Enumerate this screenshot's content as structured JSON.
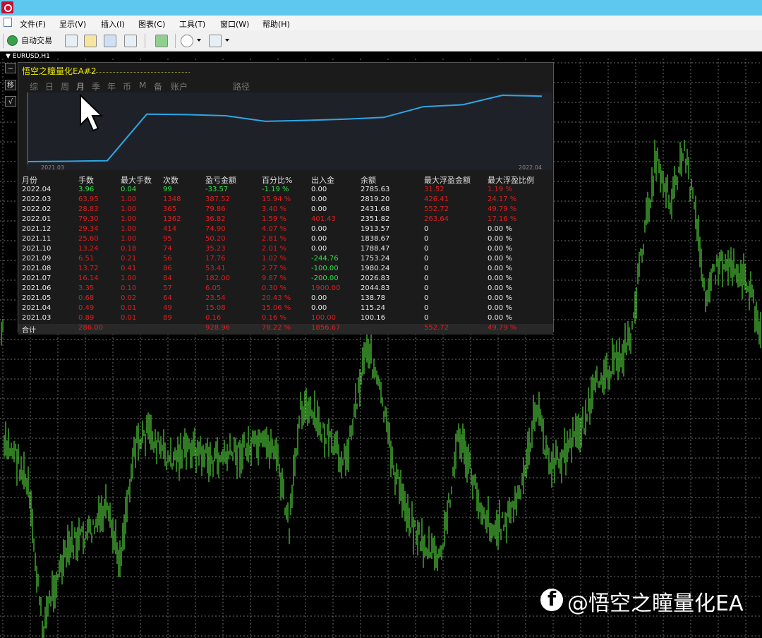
{
  "menubar": {
    "items": [
      "文件(F)",
      "显示(V)",
      "插入(I)",
      "图表(C)",
      "工具(T)",
      "窗口(W)",
      "帮助(H)"
    ]
  },
  "toolbar": {
    "autotrade_label": "自动交易"
  },
  "chart": {
    "symbol_label": "▼ EURUSD,H1",
    "side_buttons": [
      "−",
      "移",
      "√"
    ]
  },
  "panel": {
    "ea_name": "悟空之瞳量化EA#2",
    "tabs": [
      "综",
      "日",
      "周",
      "月",
      "季",
      "年",
      "币",
      "M",
      "备",
      "账户",
      "路径"
    ],
    "active_tab": "月",
    "balance_chart": {
      "x_start_label": "2021.03",
      "x_end_label": "2022.04",
      "line_color": "#2ea6e6"
    },
    "table": {
      "headers": [
        "月份",
        "手数",
        "最大手数",
        "次数",
        "盈亏金额",
        "百分比%",
        "出入金",
        "余额",
        "最大浮盈金额",
        "最大浮盈比例"
      ],
      "rows": [
        [
          "2022.04",
          "3.96",
          "0.04",
          "99",
          "-33.57",
          "-1.19 %",
          "0.00",
          "2785.63",
          "31.52",
          "1.19 %"
        ],
        [
          "2022.03",
          "63.95",
          "1.00",
          "1348",
          "387.52",
          "15.94 %",
          "0.00",
          "2819.20",
          "426.41",
          "24.17 %"
        ],
        [
          "2022.02",
          "28.83",
          "1.00",
          "365",
          "79.86",
          "3.40 %",
          "0.00",
          "2431.68",
          "552.72",
          "49.79 %"
        ],
        [
          "2022.01",
          "79.30",
          "1.00",
          "1362",
          "36.82",
          "1.59 %",
          "401.43",
          "2351.82",
          "263.64",
          "17.16 %"
        ],
        [
          "2021.12",
          "29.34",
          "1.00",
          "414",
          "74.90",
          "4.07 %",
          "0.00",
          "1913.57",
          "0",
          "0.00 %"
        ],
        [
          "2021.11",
          "25.60",
          "1.00",
          "95",
          "50.20",
          "2.81 %",
          "0.00",
          "1838.67",
          "0",
          "0.00 %"
        ],
        [
          "2021.10",
          "13.24",
          "0.18",
          "74",
          "35.23",
          "2.01 %",
          "0.00",
          "1788.47",
          "0",
          "0.00 %"
        ],
        [
          "2021.09",
          "6.51",
          "0.21",
          "56",
          "17.76",
          "1.02 %",
          "-244.76",
          "1753.24",
          "0",
          "0.00 %"
        ],
        [
          "2021.08",
          "13.72",
          "0.41",
          "86",
          "53.41",
          "2.77 %",
          "-100.00",
          "1980.24",
          "0",
          "0.00 %"
        ],
        [
          "2021.07",
          "16.14",
          "1.00",
          "84",
          "182.00",
          "9.87 %",
          "-200.00",
          "2026.83",
          "0",
          "0.00 %"
        ],
        [
          "2021.06",
          "3.35",
          "0.10",
          "57",
          "6.05",
          "0.30 %",
          "1900.00",
          "2044.83",
          "0",
          "0.00 %"
        ],
        [
          "2021.05",
          "0.68",
          "0.02",
          "64",
          "23.54",
          "20.43 %",
          "0.00",
          "138.78",
          "0",
          "0.00 %"
        ],
        [
          "2021.04",
          "0.49",
          "0.01",
          "49",
          "15.08",
          "15.06 %",
          "0.00",
          "115.24",
          "0",
          "0.00 %"
        ],
        [
          "2021.03",
          "0.89",
          "0.01",
          "89",
          "0.16",
          "0.16 %",
          "100.00",
          "100.16",
          "0",
          "0.00 %"
        ]
      ],
      "total": [
        "合计",
        "286.00",
        "",
        "",
        "928.96",
        "78.22 %",
        "1856.67",
        "",
        "552.72",
        "49.79 %"
      ]
    }
  },
  "watermark": "@悟空之瞳量化EA",
  "colors": {
    "titlebar": "#5fc8ee",
    "candles": "#4fcc3a",
    "positive": "#e01e1e",
    "negative": "#33e04a",
    "ea_name": "#e6e600"
  }
}
